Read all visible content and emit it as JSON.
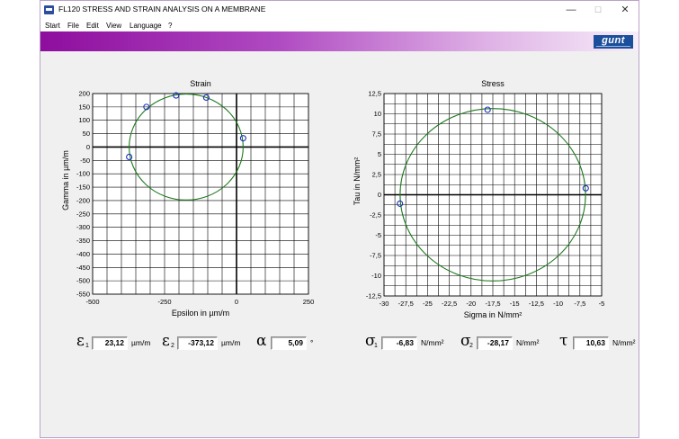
{
  "window": {
    "title": "FL120 STRESS AND STRAIN ANALYSIS ON A MEMBRANE",
    "controls": {
      "minimize": "—",
      "maximize": "☐",
      "close": "✕"
    }
  },
  "menu": [
    "Start",
    "File",
    "Edit",
    "View",
    "Language",
    "?"
  ],
  "logo_text": "gunt",
  "colors": {
    "title_gradient_start": "#8e0d9e",
    "circle": "#1f7a1f",
    "points": "#1a2fbf",
    "grid": "#000000"
  },
  "chart_data": [
    {
      "type": "scatter",
      "title": "Strain",
      "xlabel": "Epsilon in µm/m",
      "ylabel": "Gamma in µm/m",
      "xlim": [
        -500,
        250
      ],
      "ylim": [
        -550,
        200
      ],
      "x_ticks": [
        -500,
        -250,
        0,
        250
      ],
      "x_tick_labels": [
        "-500",
        "-250",
        "0",
        "250"
      ],
      "y_ticks": [
        200,
        150,
        100,
        50,
        0,
        -50,
        -100,
        -150,
        -200,
        -250,
        -300,
        -350,
        -400,
        -450,
        -500,
        -550
      ],
      "y_tick_labels": [
        "200",
        "150",
        "100",
        "50",
        "0",
        "-50",
        "-100",
        "-150",
        "-200",
        "-250",
        "-300",
        "-350",
        "-400",
        "-450",
        "-500",
        "-550"
      ],
      "x_grid_step": 50,
      "y_grid_step": 50,
      "grid": true,
      "circle": {
        "center": [
          -175,
          0
        ],
        "radius": 198
      },
      "points": [
        {
          "x": 23,
          "y": 33
        },
        {
          "x": -105,
          "y": 185
        },
        {
          "x": -210,
          "y": 193
        },
        {
          "x": -313,
          "y": 150
        },
        {
          "x": -373,
          "y": -37
        }
      ]
    },
    {
      "type": "scatter",
      "title": "Stress",
      "xlabel": "Sigma in N/mm²",
      "ylabel": "Tau in N/mm²",
      "xlim": [
        -30,
        -5
      ],
      "ylim": [
        -12.5,
        12.5
      ],
      "x_ticks": [
        -30,
        -27.5,
        -25,
        -22.5,
        -20,
        -17.5,
        -15,
        -12.5,
        -10,
        -7.5,
        -5
      ],
      "x_tick_labels": [
        "-30",
        "-27,5",
        "-25",
        "-22,5",
        "-20",
        "-17,5",
        "-15",
        "-12,5",
        "-10",
        "-7,5",
        "-5"
      ],
      "y_ticks": [
        12.5,
        10,
        7.5,
        5,
        2.5,
        0,
        -2.5,
        -5,
        -7.5,
        -10,
        -12.5
      ],
      "y_tick_labels": [
        "12,5",
        "10",
        "7,5",
        "5",
        "2,5",
        "0",
        "-2,5",
        "-5",
        "-7,5",
        "-10",
        "-12,5"
      ],
      "x_grid_step": 1.25,
      "y_grid_step": 1.25,
      "grid": true,
      "circle": {
        "center": [
          -17.5,
          0
        ],
        "radius": 10.65
      },
      "points": [
        {
          "x": -6.83,
          "y": 0.8
        },
        {
          "x": -18.1,
          "y": 10.5
        },
        {
          "x": -28.17,
          "y": -1.1
        }
      ]
    }
  ],
  "readouts": [
    {
      "symbol": "ε",
      "sub": "1",
      "value": "23,12",
      "unit": "µm/m"
    },
    {
      "symbol": "ε",
      "sub": "2",
      "value": "-373,12",
      "unit": "µm/m"
    },
    {
      "symbol": "α",
      "sub": "",
      "value": "5,09",
      "unit": "°"
    },
    {
      "symbol": "σ",
      "sub": "1",
      "value": "-6,83",
      "unit": "N/mm²"
    },
    {
      "symbol": "σ",
      "sub": "2",
      "value": "-28,17",
      "unit": "N/mm²"
    },
    {
      "symbol": "τ",
      "sub": "",
      "value": "10,63",
      "unit": "N/mm²"
    }
  ]
}
